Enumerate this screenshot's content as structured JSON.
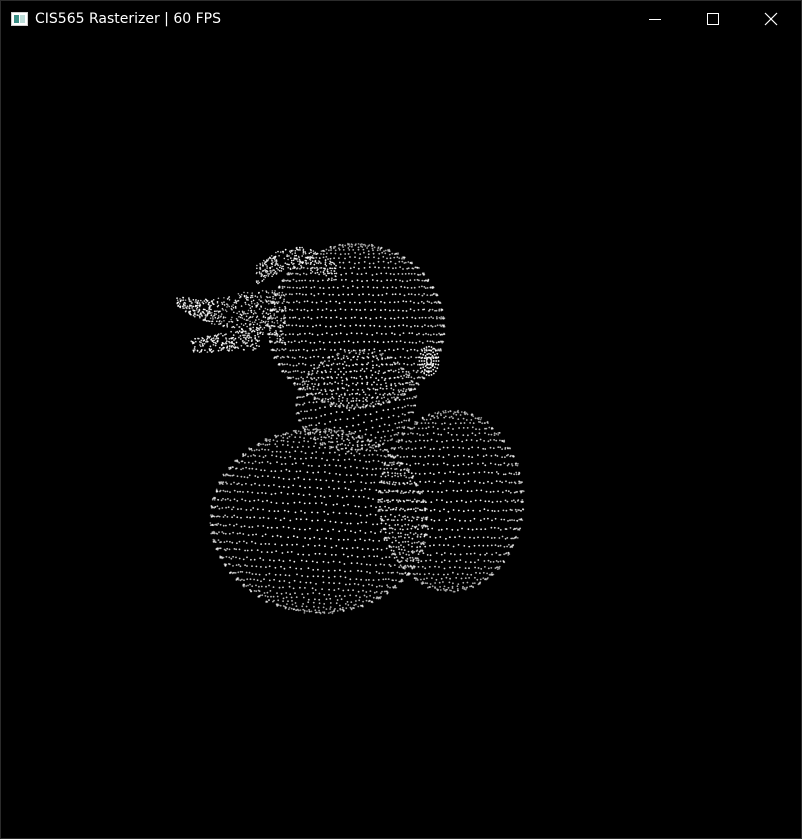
{
  "window": {
    "title": "CIS565 Rasterizer | 60 FPS",
    "icon": "app-window-icon",
    "background": "#000000",
    "controls": [
      {
        "name": "minimize",
        "icon": "minimize-icon"
      },
      {
        "name": "maximize",
        "icon": "maximize-icon"
      },
      {
        "name": "close",
        "icon": "close-icon"
      }
    ]
  },
  "render": {
    "model": "duck",
    "mode": "points",
    "point_color": "#ffffff",
    "clear_color": "#000000"
  }
}
